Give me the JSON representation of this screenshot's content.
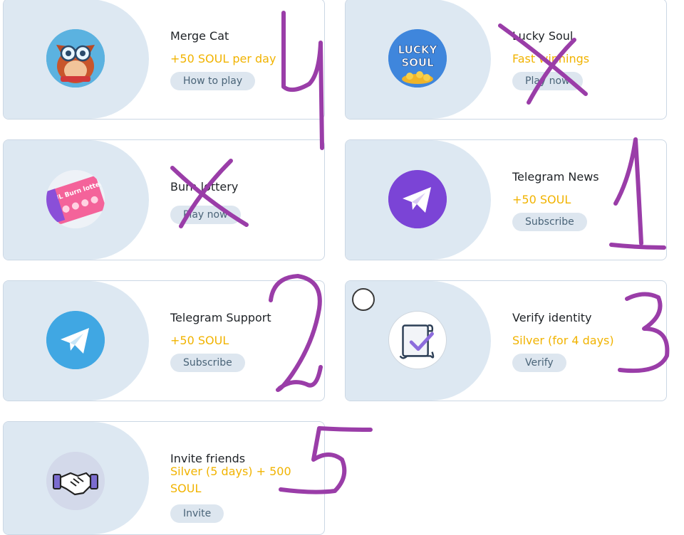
{
  "cards": {
    "merge_cat": {
      "title": "Merge Cat",
      "reward": "+50 SOUL per day",
      "button": "How to play",
      "icon": "merge-cat-game-avatar"
    },
    "lucky_soul": {
      "title": "Lucky Soul",
      "reward": "Fast winnings",
      "button": "Play now",
      "icon": "lucky-soul-coins-logo",
      "logo_line1": "LUCKY",
      "logo_line2": "SOUL"
    },
    "burn_lottery": {
      "title": "Burn lottery",
      "reward": "",
      "button": "Play now",
      "icon": "lottery-ticket-icon",
      "ticket_text": "SOUL Burn lottery"
    },
    "telegram_news": {
      "title": "Telegram News",
      "reward": "+50 SOUL",
      "button": "Subscribe",
      "icon": "telegram-plane-icon"
    },
    "telegram_support": {
      "title": "Telegram Support",
      "reward": "+50 SOUL",
      "button": "Subscribe",
      "icon": "telegram-plane-icon"
    },
    "verify_identity": {
      "title": "Verify identity",
      "reward": "Silver (for 4 days)",
      "button": "Verify",
      "icon": "scroll-checkmark-icon"
    },
    "invite_friends": {
      "title": "Invite friends",
      "reward": "Silver (5 days) + 500 SOUL",
      "button": "Invite",
      "icon": "handshake-icon"
    }
  },
  "colors": {
    "reward": "#f1b300",
    "card_bg": "#dde8f2",
    "button_bg": "#dde6ef",
    "telegram_blue": "#40a7e3",
    "telegram_purple": "#7b44d6",
    "annotation": "#9a3da8"
  },
  "annotations": [
    "4",
    "x",
    "x",
    "1",
    "2",
    "3",
    "5"
  ]
}
